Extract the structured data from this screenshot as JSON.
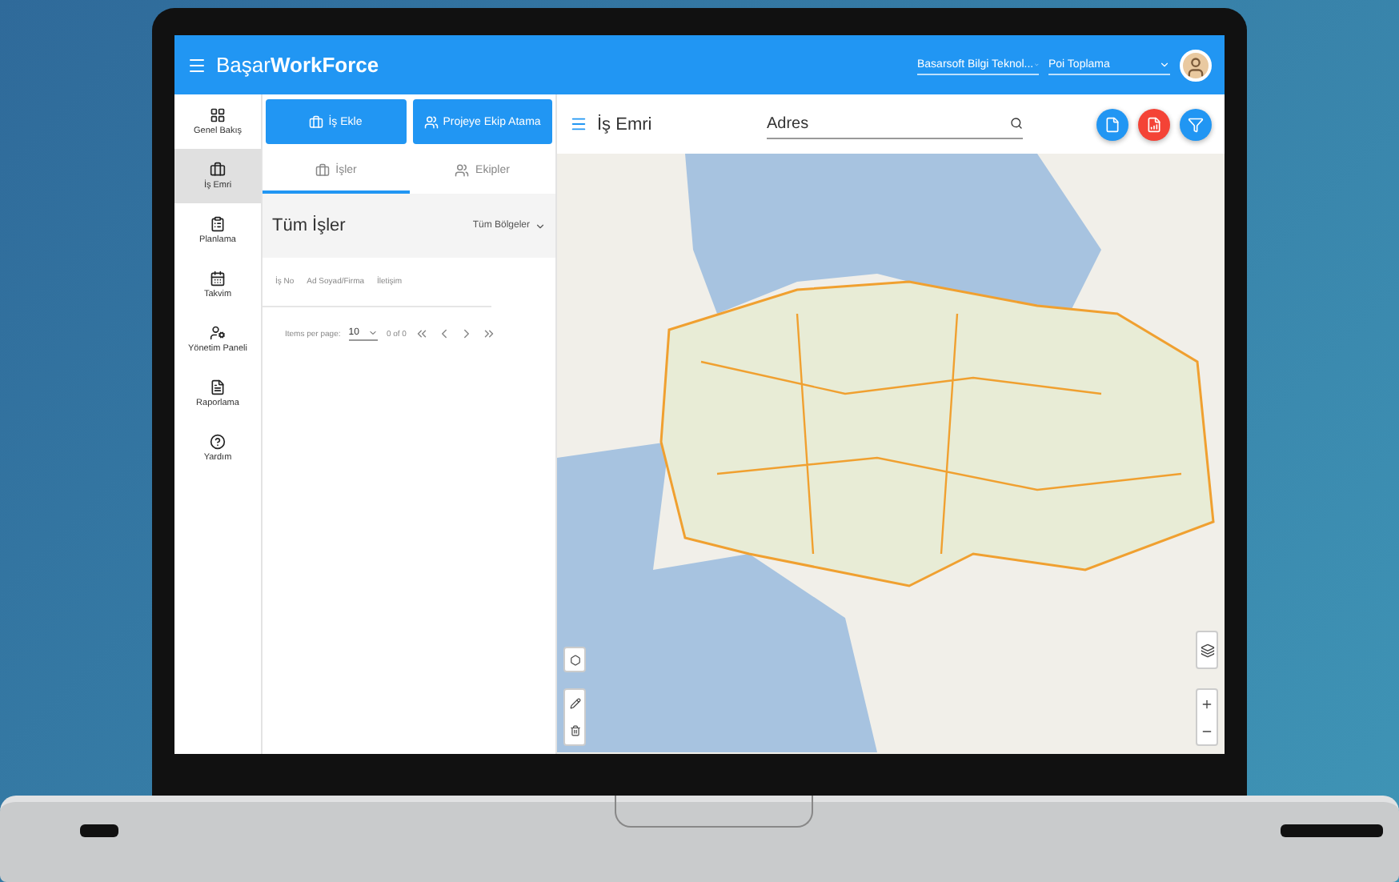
{
  "topbar": {
    "brand_regular": "Başar",
    "brand_bold": "WorkForce",
    "company": "Basarsoft Bilgi Teknol...",
    "project": "Poi Toplama"
  },
  "sidebar": {
    "items": [
      {
        "label": "Genel Bakış",
        "selected": false
      },
      {
        "label": "İş Emri",
        "selected": true
      },
      {
        "label": "Planlama",
        "selected": false
      },
      {
        "label": "Takvim",
        "selected": false
      },
      {
        "label": "Yönetim Paneli",
        "selected": false
      },
      {
        "label": "Raporlama",
        "selected": false
      },
      {
        "label": "Yardım",
        "selected": false
      }
    ]
  },
  "actions": [
    {
      "label": "İş Ekle"
    },
    {
      "label": "Projeye Ekip Atama"
    }
  ],
  "tabs": [
    {
      "label": "İşler",
      "selected": true
    },
    {
      "label": "Ekipler",
      "selected": false
    }
  ],
  "list": {
    "title": "Tüm İşler",
    "filter": "Tüm Bölgeler",
    "columns": [
      "İş No",
      "Ad Soyad/Firma",
      "İletişim"
    ],
    "per_page_label": "Items per page:",
    "per_page": "10",
    "range": "0 of 0"
  },
  "map_header": {
    "title": "İş Emri",
    "search_placeholder": "Adres"
  }
}
